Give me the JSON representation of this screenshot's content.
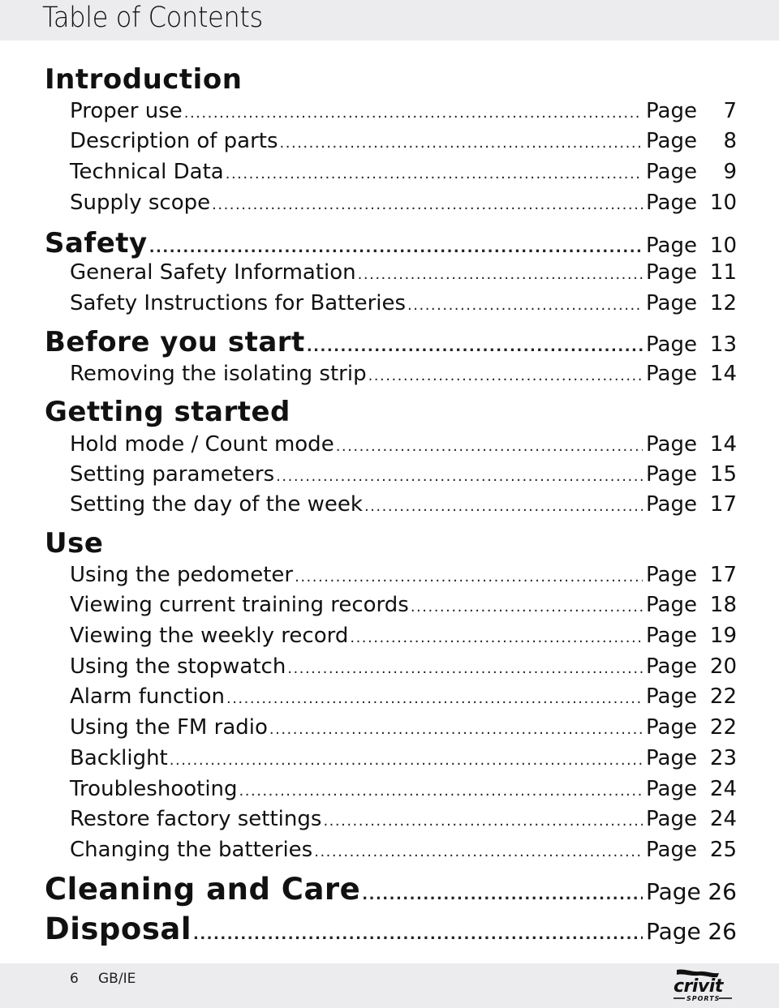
{
  "header": {
    "title": "Table of Contents"
  },
  "toc": [
    {
      "type": "section",
      "label": "Introduction",
      "page_word": "",
      "page": ""
    },
    {
      "type": "item",
      "label": "Proper use",
      "page_word": "Page",
      "page": "7"
    },
    {
      "type": "item",
      "label": "Description of parts",
      "page_word": "Page",
      "page": "8"
    },
    {
      "type": "item",
      "label": "Technical Data",
      "page_word": "Page",
      "page": "9"
    },
    {
      "type": "item",
      "label": "Supply scope",
      "page_word": "Page",
      "page": "10"
    },
    {
      "type": "section",
      "label": "Safety",
      "page_word": "Page",
      "page": "10"
    },
    {
      "type": "item",
      "label": "General Safety Information",
      "page_word": "Page",
      "page": "11"
    },
    {
      "type": "item",
      "label": "Safety Instructions for Batteries",
      "page_word": "Page",
      "page": "12"
    },
    {
      "type": "section",
      "label": "Before you start",
      "page_word": "Page",
      "page": "13"
    },
    {
      "type": "item",
      "label": "Removing the isolating strip",
      "page_word": "Page",
      "page": "14"
    },
    {
      "type": "section",
      "label": "Getting started",
      "page_word": "",
      "page": ""
    },
    {
      "type": "item",
      "label": "Hold mode / Count mode",
      "page_word": "Page",
      "page": "14"
    },
    {
      "type": "item",
      "label": "Setting parameters",
      "page_word": "Page",
      "page": "15"
    },
    {
      "type": "item",
      "label": "Setting the day of the week",
      "page_word": "Page",
      "page": "17"
    },
    {
      "type": "section",
      "label": "Use",
      "page_word": "",
      "page": ""
    },
    {
      "type": "item",
      "label": "Using the pedometer",
      "page_word": "Page",
      "page": "17"
    },
    {
      "type": "item",
      "label": "Viewing current training records",
      "page_word": "Page",
      "page": "18"
    },
    {
      "type": "item",
      "label": "Viewing the weekly record",
      "page_word": "Page",
      "page": "19"
    },
    {
      "type": "item",
      "label": "Using the stopwatch",
      "page_word": "Page",
      "page": "20"
    },
    {
      "type": "item",
      "label": "Alarm function",
      "page_word": "Page",
      "page": "22"
    },
    {
      "type": "item",
      "label": "Using the FM radio",
      "page_word": "Page",
      "page": "22"
    },
    {
      "type": "item",
      "label": "Backlight",
      "page_word": "Page",
      "page": "23"
    },
    {
      "type": "item",
      "label": "Troubleshooting",
      "page_word": "Page",
      "page": "24"
    },
    {
      "type": "item",
      "label": "Restore factory settings",
      "page_word": "Page",
      "page": "24"
    },
    {
      "type": "item",
      "label": "Changing the batteries",
      "page_word": "Page",
      "page": "25"
    },
    {
      "type": "section-big",
      "label": "Cleaning and Care",
      "page_word": "Page",
      "page": "26"
    },
    {
      "type": "section-big",
      "label": "Disposal",
      "page_word": "Page",
      "page": "26"
    }
  ],
  "footer": {
    "page_number": "6",
    "region": "GB/IE",
    "brand": {
      "name": "crivit",
      "tagline": "SPORTS",
      "icon": "crivit-sports-logo"
    }
  }
}
